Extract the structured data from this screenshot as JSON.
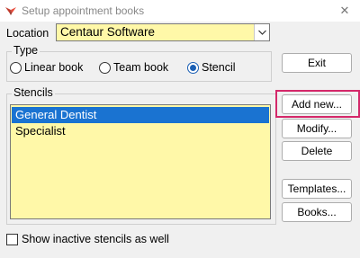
{
  "window": {
    "title": "Setup appointment books",
    "close_symbol": "✕"
  },
  "location": {
    "label": "Location",
    "value": "Centaur Software"
  },
  "type_group": {
    "title": "Type",
    "options": [
      {
        "label": "Linear book",
        "checked": false
      },
      {
        "label": "Team book",
        "checked": false
      },
      {
        "label": "Stencil",
        "checked": true
      }
    ]
  },
  "stencils": {
    "title": "Stencils",
    "items": [
      {
        "label": "General Dentist",
        "selected": true
      },
      {
        "label": "Specialist",
        "selected": false
      }
    ]
  },
  "buttons": {
    "exit": "Exit",
    "add_new": "Add new...",
    "modify": "Modify...",
    "delete": "Delete",
    "templates": "Templates...",
    "books": "Books..."
  },
  "show_inactive": {
    "label": "Show inactive stencils as well",
    "checked": false
  },
  "colors": {
    "field_background": "#fff8a8",
    "selection": "#1a73d1",
    "highlight": "#d4286a"
  }
}
